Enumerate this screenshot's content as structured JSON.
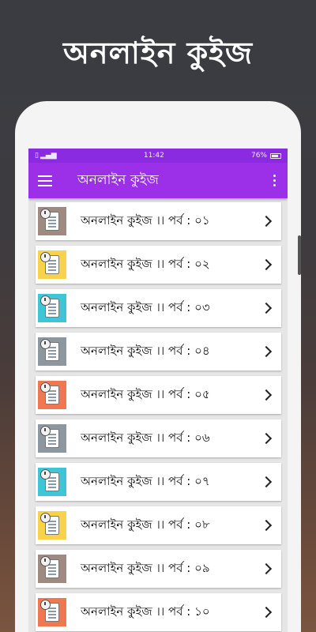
{
  "promo": {
    "title": "অনলাইন কুইজ"
  },
  "statusbar": {
    "time": "11:42",
    "battery": "76%"
  },
  "appbar": {
    "title": "অনলাইন কুইজ"
  },
  "list": {
    "items": [
      {
        "label": "অনলাইন কুইজ ।। পর্ব : ০১",
        "color": "#9e8a80"
      },
      {
        "label": "অনলাইন কুইজ ।। পর্ব : ০২",
        "color": "#f7d24a"
      },
      {
        "label": "অনলাইন কুইজ ।। পর্ব : ০৩",
        "color": "#3fc6d6"
      },
      {
        "label": "অনলাইন কুইজ ।। পর্ব : ০৪",
        "color": "#8d979f"
      },
      {
        "label": "অনলাইন কুইজ ।। পর্ব : ০৫",
        "color": "#f07850"
      },
      {
        "label": "অনলাইন কুইজ ।। পর্ব : ০৬",
        "color": "#8d979f"
      },
      {
        "label": "অনলাইন কুইজ ।। পর্ব : ০৭",
        "color": "#3fc6d6"
      },
      {
        "label": "অনলাইন কুইজ ।। পর্ব : ০৮",
        "color": "#f7d24a"
      },
      {
        "label": "অনলাইন কুইজ ।। পর্ব : ০৯",
        "color": "#9e8a80"
      },
      {
        "label": "অনলাইন কুইজ ।। পর্ব : ১০",
        "color": "#f07850"
      }
    ]
  },
  "colors": {
    "statusbar": "#8a2be2",
    "appbar": "#9b30e8"
  }
}
